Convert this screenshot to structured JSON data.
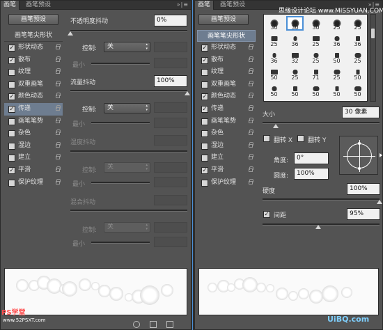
{
  "left_panel": {
    "tabs": [
      "画笔",
      "画笔预设"
    ],
    "tab_menu_icon": "»|≡",
    "preset_button": "画笔预设",
    "list_header": "画笔笔尖形状",
    "items": [
      {
        "label": "形状动态",
        "checked": true,
        "selected": false
      },
      {
        "label": "散布",
        "checked": true,
        "selected": false
      },
      {
        "label": "纹理",
        "checked": false,
        "selected": false
      },
      {
        "label": "双重画笔",
        "checked": false,
        "selected": false
      },
      {
        "label": "颜色动态",
        "checked": true,
        "selected": false
      },
      {
        "label": "传递",
        "checked": true,
        "selected": true
      },
      {
        "label": "画笔笔势",
        "checked": false,
        "selected": false
      },
      {
        "label": "杂色",
        "checked": false,
        "selected": false
      },
      {
        "label": "湿边",
        "checked": false,
        "selected": false
      },
      {
        "label": "建立",
        "checked": false,
        "selected": false
      },
      {
        "label": "平滑",
        "checked": true,
        "selected": false
      },
      {
        "label": "保护纹理",
        "checked": false,
        "selected": false
      }
    ],
    "opacity_jitter": {
      "label": "不透明度抖动",
      "value": "0%",
      "control_label": "控制:",
      "control_value": "关",
      "min_label": "最小"
    },
    "flow_jitter": {
      "label": "流量抖动",
      "value": "100%",
      "control_label": "控制:",
      "control_value": "关",
      "min_label": "最小"
    },
    "wetness_jitter": {
      "label": "湿度抖动",
      "control_label": "控制:",
      "control_value": "关",
      "min_label": "最小"
    },
    "mix_jitter": {
      "label": "混合抖动",
      "control_label": "控制:",
      "control_value": "关",
      "min_label": "最小"
    }
  },
  "right_panel": {
    "tabs": [
      "画笔",
      "画笔预设"
    ],
    "tab_menu_icon": "»|≡",
    "preset_button": "画笔预设",
    "list_header": "画笔笔尖形状",
    "items": [
      {
        "label": "形状动态",
        "checked": true
      },
      {
        "label": "散布",
        "checked": true
      },
      {
        "label": "纹理",
        "checked": false
      },
      {
        "label": "双重画笔",
        "checked": false
      },
      {
        "label": "颜色动态",
        "checked": true
      },
      {
        "label": "传递",
        "checked": true
      },
      {
        "label": "画笔笔势",
        "checked": false
      },
      {
        "label": "杂色",
        "checked": false
      },
      {
        "label": "湿边",
        "checked": false
      },
      {
        "label": "建立",
        "checked": false
      },
      {
        "label": "平滑",
        "checked": true
      },
      {
        "label": "保护纹理",
        "checked": false
      }
    ],
    "brush_tips": [
      [
        "30",
        "30",
        "30",
        "25",
        "25"
      ],
      [
        "25",
        "36",
        "25",
        "36",
        "36"
      ],
      [
        "36",
        "32",
        "25",
        "50",
        "25"
      ],
      [
        "50",
        "25",
        "71",
        "25",
        "50"
      ],
      [
        "50",
        "50",
        "50",
        "50",
        "50"
      ]
    ],
    "selected_tip_index": 1,
    "size": {
      "label": "大小",
      "value": "30 像素"
    },
    "flip_x": {
      "label": "翻转 X",
      "checked": false
    },
    "flip_y": {
      "label": "翻转 Y",
      "checked": false
    },
    "angle": {
      "label": "角度:",
      "value": "0°"
    },
    "roundness": {
      "label": "圆度:",
      "value": "100%"
    },
    "hardness": {
      "label": "硬度",
      "value": "100%"
    },
    "spacing": {
      "label": "间距",
      "value": "95%",
      "checked": true
    }
  },
  "watermarks": {
    "top_right": "思缘设计论坛 www.MISSYUAN.COM",
    "bottom_left": "PS学堂",
    "bottom_left_url": "www.52PSXT.com",
    "bottom_right_logo": "UiBQ.com"
  }
}
